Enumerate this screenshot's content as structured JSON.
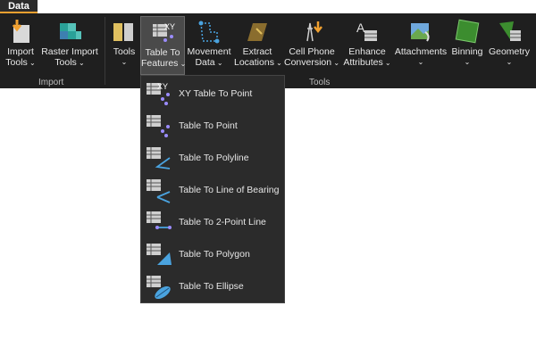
{
  "tab": {
    "label": "Data"
  },
  "groups": {
    "import": "Import",
    "tools": "Tools"
  },
  "ribbon": {
    "import_tools": {
      "line1": "Import",
      "line2": "Tools"
    },
    "raster_import_tools": {
      "line1": "Raster Import",
      "line2": "Tools"
    },
    "tools": {
      "line1": "Tools",
      "line2": ""
    },
    "table_to_features": {
      "line1": "Table To",
      "line2": "Features"
    },
    "movement_data": {
      "line1": "Movement",
      "line2": "Data"
    },
    "extract_locations": {
      "line1": "Extract",
      "line2": "Locations"
    },
    "cell_phone_conversion": {
      "line1": "Cell Phone",
      "line2": "Conversion"
    },
    "enhance_attributes": {
      "line1": "Enhance",
      "line2": "Attributes"
    },
    "attachments": {
      "line1": "Attachments",
      "line2": ""
    },
    "binning": {
      "line1": "Binning",
      "line2": ""
    },
    "geometry": {
      "line1": "Geometry",
      "line2": ""
    }
  },
  "menu": {
    "items": [
      {
        "label": "XY Table To Point",
        "icon": "xy-table-to-point-icon"
      },
      {
        "label": "Table To Point",
        "icon": "table-to-point-icon"
      },
      {
        "label": "Table To Polyline",
        "icon": "table-to-polyline-icon"
      },
      {
        "label": "Table To Line of Bearing",
        "icon": "table-to-line-of-bearing-icon"
      },
      {
        "label": "Table To 2-Point Line",
        "icon": "table-to-2-point-line-icon"
      },
      {
        "label": "Table To Polygon",
        "icon": "table-to-polygon-icon"
      },
      {
        "label": "Table To Ellipse",
        "icon": "table-to-ellipse-icon"
      }
    ]
  },
  "colors": {
    "ribbon_bg": "#1f1f1f",
    "menu_bg": "#2b2b2b",
    "accent": "#f0a030",
    "icon_blue": "#4aa3df"
  }
}
